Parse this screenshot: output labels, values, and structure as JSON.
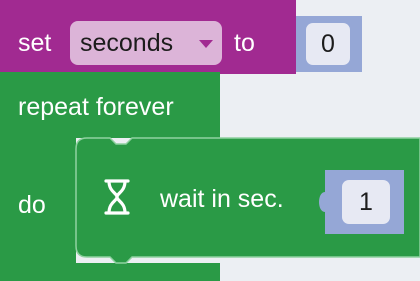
{
  "colors": {
    "variable_block": "#a12a91",
    "dropdown_bg": "#dcb4d8",
    "dropdown_arrow": "#a12a91",
    "loop_block": "#2a9a46",
    "number_block": "#95a7d6",
    "number_field": "#e7e9f3",
    "workspace": "#eceff3"
  },
  "set_block": {
    "prefix": "set",
    "variable": "seconds",
    "joiner": "to",
    "value": "0"
  },
  "repeat_block": {
    "title": "repeat forever",
    "do_label": "do"
  },
  "wait_block": {
    "icon": "hourglass-icon",
    "label": "wait in sec.",
    "value": "1"
  }
}
